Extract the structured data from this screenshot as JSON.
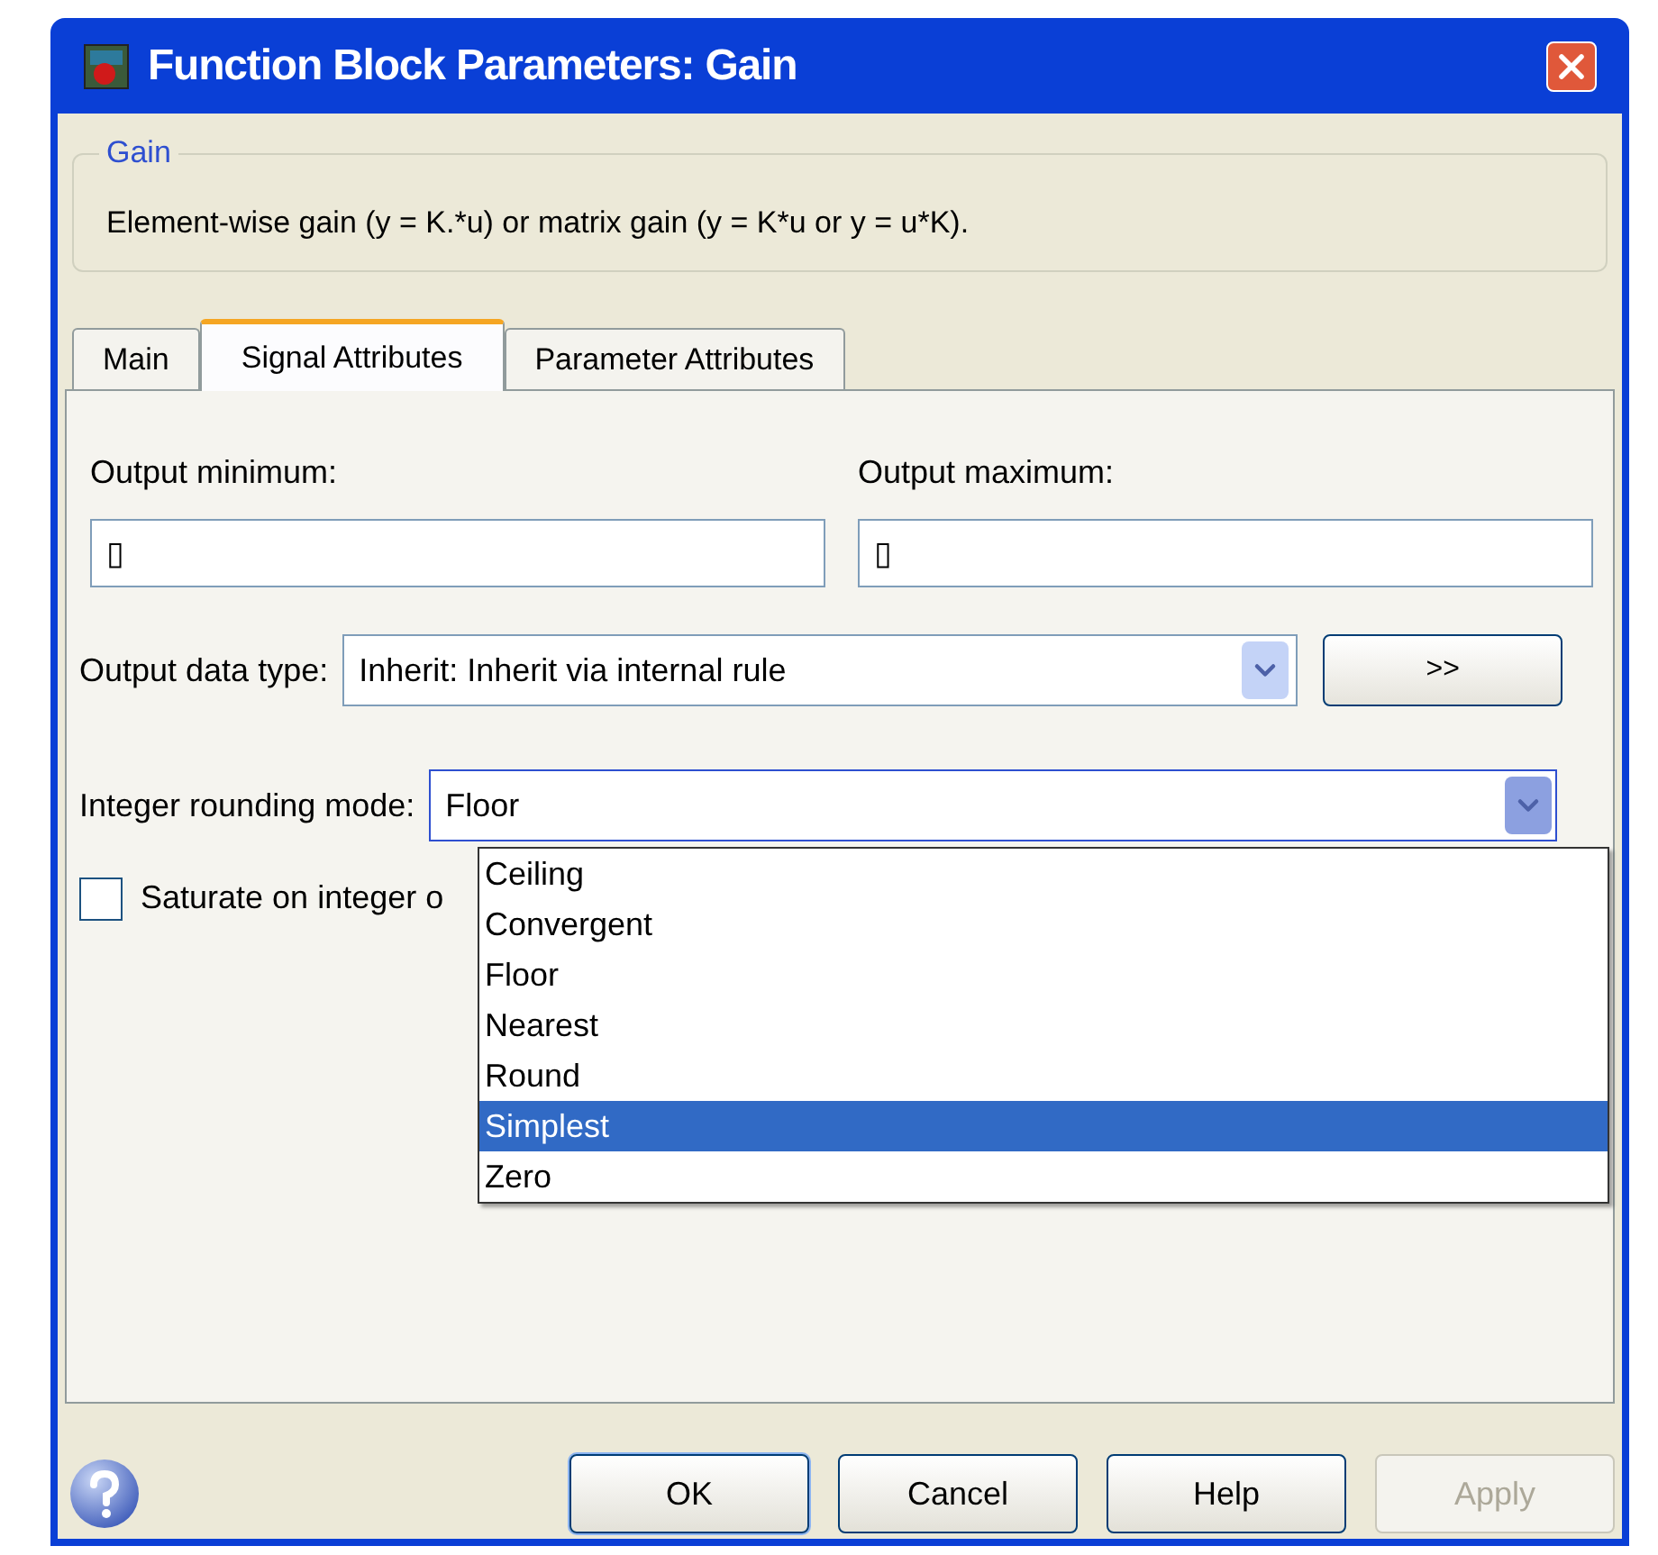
{
  "window": {
    "title": "Function Block Parameters: Gain"
  },
  "group": {
    "legend": "Gain",
    "description": "Element-wise gain (y = K.*u) or matrix gain (y = K*u or y = u*K)."
  },
  "tabs": [
    {
      "label": "Main",
      "selected": false
    },
    {
      "label": "Signal Attributes",
      "selected": true
    },
    {
      "label": "Parameter Attributes",
      "selected": false
    }
  ],
  "output_minimum": {
    "label": "Output minimum:",
    "value": "▯"
  },
  "output_maximum": {
    "label": "Output maximum:",
    "value": "▯"
  },
  "output_data_type": {
    "label": "Output data type:",
    "value": "Inherit: Inherit via internal rule",
    "button": ">>"
  },
  "rounding_mode": {
    "label": "Integer rounding mode:",
    "value": "Floor",
    "expanded": true,
    "options": [
      {
        "label": "Ceiling",
        "highlighted": false
      },
      {
        "label": "Convergent",
        "highlighted": false
      },
      {
        "label": "Floor",
        "highlighted": false
      },
      {
        "label": "Nearest",
        "highlighted": false
      },
      {
        "label": "Round",
        "highlighted": false
      },
      {
        "label": "Simplest",
        "highlighted": true
      },
      {
        "label": "Zero",
        "highlighted": false
      }
    ]
  },
  "saturate": {
    "label": "Saturate on integer o",
    "checked": false
  },
  "buttons": [
    {
      "label": "OK",
      "disabled": false
    },
    {
      "label": "Cancel",
      "disabled": false
    },
    {
      "label": "Help",
      "disabled": false
    },
    {
      "label": "Apply",
      "disabled": true
    }
  ]
}
